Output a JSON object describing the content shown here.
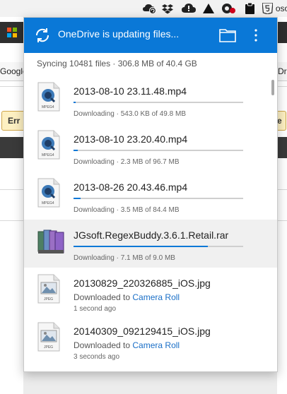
{
  "menubar": {
    "icons": [
      "onedrive-sync-icon",
      "dropbox-icon",
      "cloud-icon",
      "warning-triangle-icon",
      "lastpass-icon",
      "clipboard-icon",
      "html5-shield-icon"
    ]
  },
  "background": {
    "tab_text_left": "Google",
    "tab_text_right": "Driv",
    "error_label": "Err",
    "right_fragment": "e",
    "top_right_fragment": "oso"
  },
  "panel": {
    "header_title": "OneDrive is updating files...",
    "accent_color": "#0a78d7",
    "summary": "Syncing 10481 files · 306.8 MB of 40.4 GB",
    "items": [
      {
        "name": "2013-08-10 23.11.48.mp4",
        "type_badge": "MPEG4",
        "icon": "quicktime-mpeg4-file-icon",
        "progress": 0.011,
        "status": "Downloading · 543.0 KB of 49.8 MB"
      },
      {
        "name": "2013-08-10 23.20.40.mp4",
        "type_badge": "MPEG4",
        "icon": "quicktime-mpeg4-file-icon",
        "progress": 0.024,
        "status": "Downloading · 2.3 MB of 96.7 MB"
      },
      {
        "name": "2013-08-26 20.43.46.mp4",
        "type_badge": "MPEG4",
        "icon": "quicktime-mpeg4-file-icon",
        "progress": 0.041,
        "status": "Downloading · 3.5 MB of 84.4 MB"
      },
      {
        "name": "JGsoft.RegexBuddy.3.6.1.Retail.rar",
        "icon": "rar-archive-icon",
        "progress": 0.79,
        "status": "Downloading · 7.1 MB of 9.0 MB"
      },
      {
        "name": "20130829_220326885_iOS.jpg",
        "type_badge": "JPEG",
        "icon": "jpeg-image-file-icon",
        "status_prefix": "Downloaded to ",
        "status_link": "Camera Roll",
        "time": "1 second ago"
      },
      {
        "name": "20140309_092129415_iOS.jpg",
        "type_badge": "JPEG",
        "icon": "jpeg-image-file-icon",
        "status_prefix": "Downloaded to ",
        "status_link": "Camera Roll",
        "time": "3 seconds ago"
      }
    ]
  }
}
